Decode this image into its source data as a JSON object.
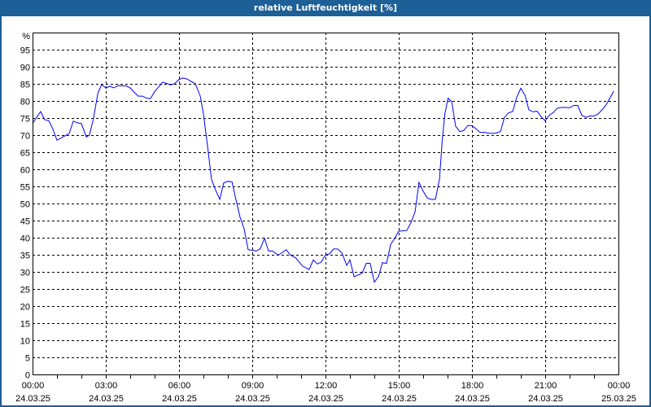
{
  "window": {
    "title": "relative Luftfeuchtigkeit [%]"
  },
  "chart_data": {
    "type": "line",
    "title": "relative Luftfeuchtigkeit [%]",
    "ylabel": "%",
    "xlabel": "",
    "ylim": [
      0,
      100
    ],
    "xlim_hours": [
      0,
      24
    ],
    "grid": true,
    "y_ticks": [
      0,
      5,
      10,
      15,
      20,
      25,
      30,
      35,
      40,
      45,
      50,
      55,
      60,
      65,
      70,
      75,
      80,
      85,
      90,
      95
    ],
    "x_ticks": [
      {
        "hour": 0,
        "time": "00:00",
        "date": "24.03.25"
      },
      {
        "hour": 3,
        "time": "03:00",
        "date": "24.03.25"
      },
      {
        "hour": 6,
        "time": "06:00",
        "date": "24.03.25"
      },
      {
        "hour": 9,
        "time": "09:00",
        "date": "24.03.25"
      },
      {
        "hour": 12,
        "time": "12:00",
        "date": "24.03.25"
      },
      {
        "hour": 15,
        "time": "15:00",
        "date": "24.03.25"
      },
      {
        "hour": 18,
        "time": "18:00",
        "date": "24.03.25"
      },
      {
        "hour": 21,
        "time": "21:00",
        "date": "24.03.25"
      },
      {
        "hour": 24,
        "time": "00:00",
        "date": "25.03.25"
      }
    ],
    "series": [
      {
        "name": "relative Luftfeuchtigkeit",
        "color": "#0000ff",
        "x_hours": [
          0,
          0.33,
          0.5,
          0.67,
          0.83,
          1.0,
          1.33,
          1.5,
          1.67,
          1.83,
          2.0,
          2.2,
          2.33,
          2.5,
          2.67,
          2.83,
          3.0,
          3.17,
          3.33,
          3.5,
          3.83,
          4.0,
          4.17,
          4.33,
          4.5,
          4.67,
          4.83,
          5.0,
          5.33,
          5.5,
          5.67,
          5.83,
          6.0,
          6.17,
          6.33,
          6.5,
          6.67,
          6.87,
          7.0,
          7.17,
          7.33,
          7.5,
          7.67,
          7.83,
          8.0,
          8.17,
          8.33,
          8.5,
          8.67,
          8.83,
          9.0,
          9.17,
          9.33,
          9.5,
          9.67,
          9.83,
          10.06,
          10.22,
          10.39,
          10.56,
          10.78,
          11.06,
          11.33,
          11.5,
          11.67,
          11.83,
          12.0,
          12.17,
          12.33,
          12.5,
          12.67,
          12.87,
          13.0,
          13.17,
          13.5,
          13.67,
          13.83,
          14.0,
          14.17,
          14.33,
          14.5,
          14.67,
          14.83,
          15.0,
          15.33,
          15.5,
          15.67,
          15.83,
          16.0,
          16.17,
          16.33,
          16.5,
          16.67,
          16.78,
          16.89,
          17.02,
          17.17,
          17.33,
          17.5,
          17.67,
          17.83,
          18.0,
          18.17,
          18.33,
          18.5,
          18.67,
          18.83,
          19.0,
          19.17,
          19.33,
          19.5,
          19.67,
          19.83,
          20.0,
          20.17,
          20.33,
          20.5,
          20.67,
          20.83,
          21.0,
          21.17,
          21.33,
          21.5,
          21.67,
          21.83,
          22.0,
          22.17,
          22.33,
          22.5,
          22.67,
          22.83,
          23.0,
          23.17,
          23.33,
          23.5,
          23.67,
          23.81
        ],
        "values": [
          73.4,
          76.9,
          74.5,
          74.2,
          71.8,
          68.5,
          69.8,
          70.5,
          74.1,
          73.6,
          73.4,
          69.5,
          70,
          75,
          82.1,
          84.8,
          83.8,
          84.3,
          83.8,
          84.5,
          84.4,
          83.8,
          82.5,
          81.4,
          81.4,
          80.8,
          80.7,
          82.7,
          85.5,
          85.1,
          84.7,
          85.1,
          86.3,
          86.7,
          86.4,
          85.7,
          85.0,
          81.4,
          76.2,
          66.7,
          57.1,
          53.9,
          51.2,
          56,
          56.5,
          56.3,
          51.2,
          46,
          42.5,
          36.5,
          36.3,
          36.1,
          36.8,
          39.8,
          36.1,
          36.1,
          34.9,
          35.6,
          36.5,
          34.9,
          34.1,
          31.7,
          30.7,
          33.5,
          32.3,
          32.9,
          34.9,
          35.3,
          36.7,
          36.7,
          35.6,
          31.9,
          33.5,
          28.6,
          29.6,
          32.5,
          32.5,
          27,
          28.6,
          32.7,
          32.5,
          38.1,
          39.7,
          41.9,
          42.1,
          44.4,
          47.6,
          56.2,
          53.6,
          51.6,
          51.2,
          51.2,
          57.1,
          68.3,
          76.2,
          80.8,
          79.8,
          72.6,
          71,
          71.4,
          72.8,
          72.8,
          71.8,
          70.8,
          70.8,
          70.6,
          70.5,
          70.6,
          71.1,
          75.2,
          76.5,
          76.9,
          81,
          83.7,
          81.7,
          77.4,
          76.8,
          77,
          75.4,
          74.2,
          75.8,
          76.6,
          77.9,
          78.1,
          78.1,
          78,
          78.7,
          78.7,
          75.8,
          75.2,
          75.6,
          75.6,
          76.2,
          77.4,
          78.9,
          81.1,
          82.9
        ]
      }
    ]
  }
}
